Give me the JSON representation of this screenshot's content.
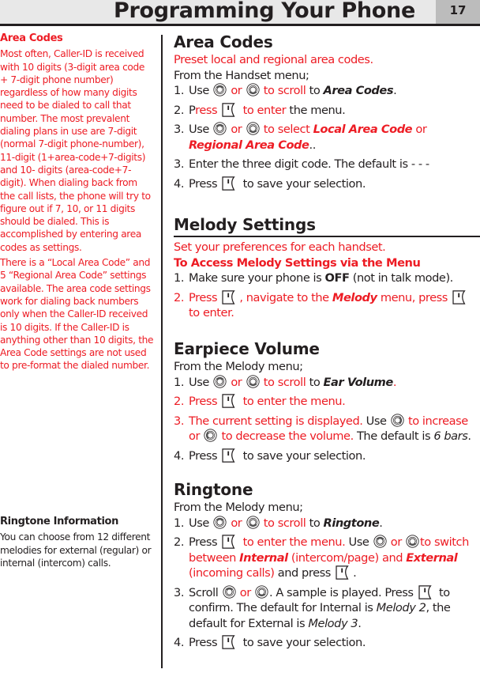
{
  "header": {
    "title": "Programming Your Phone",
    "page_number": "17"
  },
  "sidebar": {
    "area_codes": {
      "heading": "Area Codes",
      "paragraphs": [
        "Most often, Caller-ID is received with 10 digits (3-digit area code + 7-digit phone number) regardless of how many digits need to be dialed to call that number. The most prevalent dialing plans in use are 7-digit (normal 7-digit phone-number), 11-digit (1+area-code+7-digits) and 10- digits (area-code+7-digit). When dialing back from the call lists, the phone will try to figure out if 7, 10, or 11 digits should be dialed. This is accomplished by entering area codes as settings.",
        "There is a “Local Area Code” and 5 “Regional Area Code” settings available. The area code settings work for dialing back numbers only when the Caller-ID received is 10 digits. If the Caller-ID is anything other than 10 digits, the Area Code settings are not used to pre-format the dialed number."
      ]
    },
    "ringtone_info": {
      "heading": "Ringtone Information",
      "paragraphs": [
        "You can choose from 12 different melodies for external (regular) or internal (intercom) calls."
      ]
    }
  },
  "icons": {
    "nav_up": "nav-up-icon",
    "nav_down": "nav-down-icon",
    "nav_right": "nav-right-icon",
    "nav_left": "nav-left-icon",
    "softkey": "softkey-icon"
  },
  "main": {
    "area_codes": {
      "title": "Area Codes",
      "intro": "Preset local and regional area codes.",
      "from": "From the Handset menu;",
      "steps": {
        "s1": {
          "num": "1.",
          "use": "Use",
          "or": "or",
          "action": "to scroll",
          "to": "to",
          "target": "Area Codes",
          "end": "."
        },
        "s2": {
          "num": "2.",
          "p": "P",
          "ress": "ress",
          "action": "to enter",
          "rest": "the menu."
        },
        "s3": {
          "num": "3.",
          "use": "Use",
          "or": "or",
          "action": "to select",
          "opt1": "Local Area Code",
          "or2": "or",
          "opt2": "Regional Area Code",
          "end": ".."
        },
        "s4": {
          "num": "3.",
          "text": "Enter the three digit code. The default is -  - -"
        },
        "s5": {
          "num": "4.",
          "press": "Press",
          "rest": "to save your selection."
        }
      }
    },
    "melody": {
      "title": "Melody Settings",
      "intro": "Set your preferences for each handset.",
      "subhead": "To Access Melody Settings via the Menu",
      "steps": {
        "s1": {
          "num": "1.",
          "pre": "Make sure your phone is",
          "bold": "OFF",
          "post": "(not in talk mode)."
        },
        "s2": {
          "num": "2.",
          "press": "Press",
          "mid": ", navigate to the",
          "menu": "Melody",
          "post": "menu, press",
          "end": "to enter."
        }
      }
    },
    "earpiece": {
      "title": "Earpiece Volume",
      "from": "From the Melody menu;",
      "steps": {
        "s1": {
          "num": "1.",
          "use": "Use",
          "or": "or",
          "action": "to scroll",
          "to": "to",
          "target": "Ear Volume",
          "end": "."
        },
        "s2": {
          "num": "2.",
          "press": "Press",
          "rest": "to enter the menu."
        },
        "s3": {
          "num": "3.",
          "pre": "The current setting is displayed.",
          "use": "Use",
          "inc": "to increase",
          "or": "or",
          "dec": "to decrease the volume.",
          "def": "The default is",
          "val": "6 bars",
          "end": "."
        },
        "s4": {
          "num": "4.",
          "press": "Press",
          "rest": "to save your selection."
        }
      }
    },
    "ringtone": {
      "title": "Ringtone",
      "from": "From the Melody menu;",
      "steps": {
        "s1": {
          "num": "1.",
          "use": "Use",
          "or": "or",
          "action": "to scroll",
          "to": "to",
          "target": "Ringtone",
          "end": "."
        },
        "s2": {
          "num": "2.",
          "press": "Press",
          "a": "to enter the menu.",
          "use": "Use",
          "or": "or",
          "to": "to",
          "b": "switch between",
          "internal": "Internal",
          "c": "(intercom/page) and",
          "external": "External",
          "d": "(incoming calls)",
          "e": "and press",
          "end": "."
        },
        "s3": {
          "num": "3.",
          "scroll": "Scroll",
          "or": "or",
          "a": ". A sample is played. Press",
          "b": "to confirm. The default for Internal is",
          "m2": "Melody 2",
          "c": ", the default for External is",
          "m3": "Melody 3",
          "end": "."
        },
        "s4": {
          "num": "4.",
          "press": "Press",
          "rest": "to save your selection."
        }
      }
    }
  }
}
